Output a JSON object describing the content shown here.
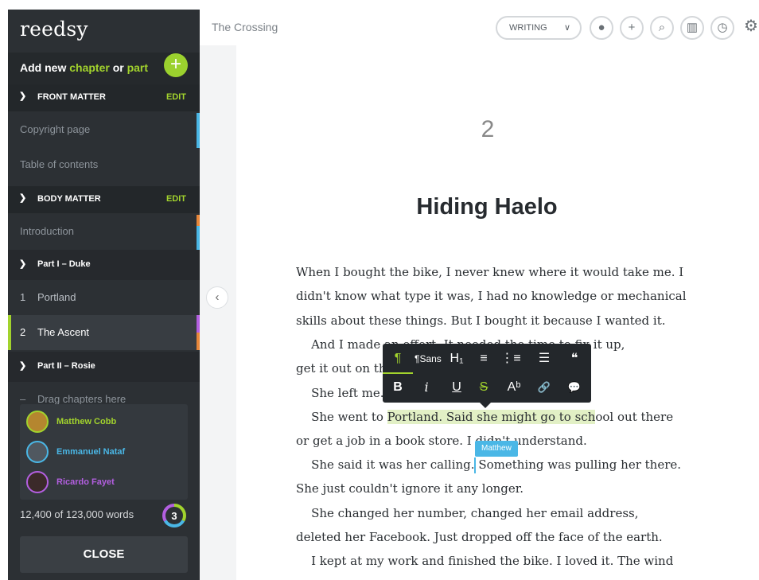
{
  "sidebar": {
    "brand": "reedsy",
    "add_label_prefix": "Add new ",
    "add_label_chapter": "chapter",
    "add_label_or": " or ",
    "add_label_part": "part",
    "add_icon": "+",
    "front_matter": {
      "label": "FRONT MATTER",
      "edit": "EDIT",
      "items": [
        "Copyright page",
        "Table of contents"
      ]
    },
    "body_matter": {
      "label": "BODY MATTER",
      "edit": "EDIT",
      "items": [
        "Introduction"
      ]
    },
    "parts": [
      {
        "label": "Part I – Duke",
        "chapters": [
          {
            "num": "1",
            "title": "Portland"
          },
          {
            "num": "2",
            "title": "The Ascent"
          }
        ]
      },
      {
        "label": "Part II – Rosie",
        "chapters": [
          {
            "num": "–",
            "title": "Drag chapters here"
          }
        ]
      }
    ],
    "collaborators": [
      {
        "name": "Matthew Cobb",
        "color": "#a2d32d"
      },
      {
        "name": "Emmanuel Nataf",
        "color": "#4ab7e6"
      },
      {
        "name": "Ricardo Fayet",
        "color": "#b35fe0"
      }
    ],
    "word_count": "12,400 of 123,000 words",
    "ring_badge": "3",
    "close_label": "CLOSE"
  },
  "topbar": {
    "book_title": "The Crossing",
    "mode": "WRITING",
    "mode_chevron": "∨"
  },
  "editor": {
    "chapter_number": "2",
    "chapter_title": "Hiding Haelo",
    "lines": [
      "When I bought the bike, I never knew where it would take me. I",
      "didn't know what type it was, I had no knowledge or mechanical",
      "skills about these things. But I bought it because I wanted it.",
      "    And I made an effort. It needed the time to fix it up,",
      "get it out on the road.",
      "    She left me.",
      "or get a job in a book store. I didn't understand.",
      "She just couldn't ignore it any longer.",
      "    She changed her number, changed her email address,",
      "deleted her Facebook. Just dropped off the face of the earth.",
      "    I kept at my work and finished the bike. I loved it. The wind"
    ],
    "hl_line": {
      "before": "    She went to ",
      "highlight": "Portland. Said she might go to sch",
      "after": "ool out there"
    },
    "calling_line": {
      "before": "    She said it was her calling.",
      "highlight": " Something was pulling her there."
    },
    "comment_author": "Matthew"
  },
  "toolbar": {
    "row1": [
      "¶",
      "¶Sans",
      "H₁",
      "≡",
      "⋮≡",
      "☰",
      "❝"
    ],
    "row2": [
      "B",
      "i",
      "U",
      "S",
      "Aᵇ",
      "🔗",
      "💬"
    ]
  }
}
